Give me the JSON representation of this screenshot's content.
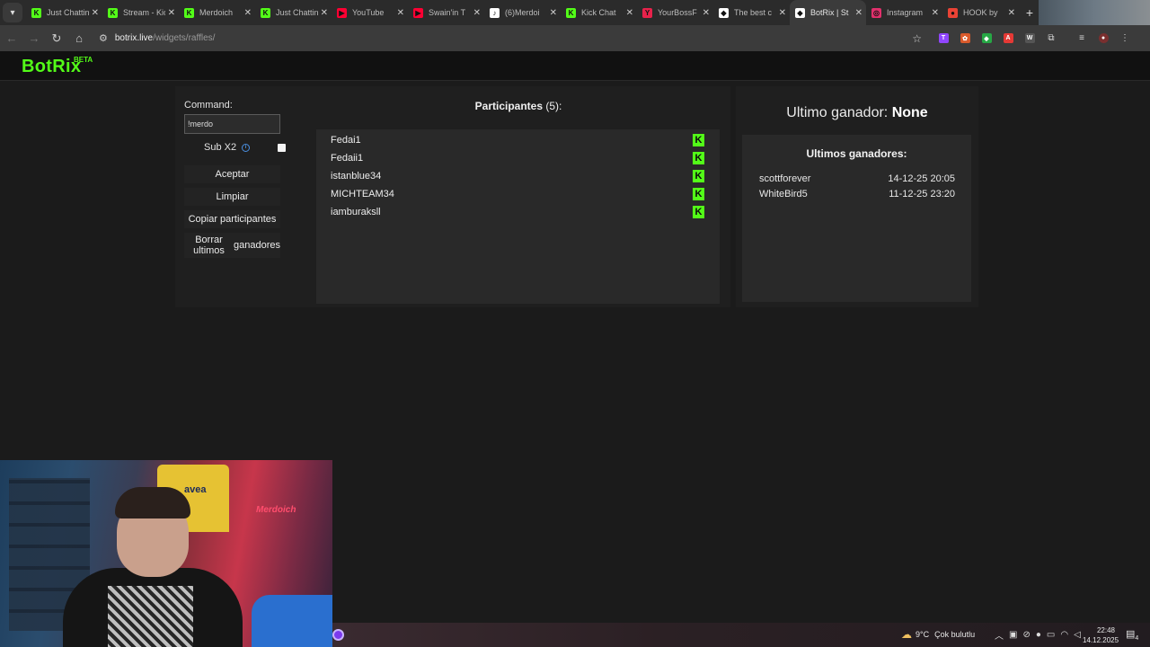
{
  "browser": {
    "tabs": [
      {
        "title": "Just Chatting",
        "fav_color": "#53fc18",
        "fav_letter": "K",
        "active": false
      },
      {
        "title": "Stream - Kick",
        "fav_color": "#53fc18",
        "fav_letter": "K",
        "active": false
      },
      {
        "title": "Merdoich",
        "fav_color": "#53fc18",
        "fav_letter": "K",
        "active": false
      },
      {
        "title": "Just Chatting",
        "fav_color": "#53fc18",
        "fav_letter": "K",
        "active": false
      },
      {
        "title": "YouTube",
        "fav_color": "#ff0033",
        "fav_letter": "▶",
        "active": false
      },
      {
        "title": "Swain'in T",
        "fav_color": "#ff0033",
        "fav_letter": "▶",
        "active": false
      },
      {
        "title": "(6)Merdoi",
        "fav_color": "#ffffff",
        "fav_letter": "♪",
        "active": false
      },
      {
        "title": "Kick Chat",
        "fav_color": "#53fc18",
        "fav_letter": "K",
        "active": false
      },
      {
        "title": "YourBossF",
        "fav_color": "#e8224b",
        "fav_letter": "Y",
        "active": false
      },
      {
        "title": "The best c",
        "fav_color": "#ffffff",
        "fav_letter": "◆",
        "active": false
      },
      {
        "title": "BotRix | St",
        "fav_color": "#ffffff",
        "fav_letter": "◆",
        "active": true
      },
      {
        "title": "Instagram",
        "fav_color": "#e1306c",
        "fav_letter": "◎",
        "active": false
      },
      {
        "title": "HOOK by",
        "fav_color": "#ea4335",
        "fav_letter": "●",
        "active": false
      }
    ],
    "url_host": "botrix.live",
    "url_path": "/widgets/raffles/"
  },
  "site": {
    "logo": "BotRix",
    "beta": "BETA"
  },
  "controls": {
    "command_label": "Command:",
    "command_value": "!merdo",
    "sub_label": "Sub X2",
    "accept": "Aceptar",
    "clear": "Limpiar",
    "copy": "Copiar participantes",
    "delete_winners_line1": "Borrar ultimos",
    "delete_winners_line2": "ganadores"
  },
  "participants": {
    "title": "Participantes",
    "count": "(5):",
    "list": [
      "Fedai1",
      "Fedaii1",
      "istanblue34",
      "MICHTEAM34",
      "iamburaksll"
    ]
  },
  "winners": {
    "last_label": "Ultimo ganador:",
    "last_value": "None",
    "box_title": "Ultimos ganadores:",
    "list": [
      {
        "name": "scottforever",
        "date": "14-12-25 20:05"
      },
      {
        "name": "WhiteBird5",
        "date": "11-12-25 23:20"
      }
    ]
  },
  "webcam": {
    "jersey_text": "avea",
    "sign_text": "Merdoich"
  },
  "taskbar": {
    "temperature": "9°C",
    "condition": "Çok bulutlu",
    "time": "22:48",
    "date": "14.12.2025",
    "notifications": "4"
  },
  "colors": {
    "kick_green": "#53fc18",
    "background": "#1b1b1b",
    "panel": "#1f1f1f",
    "list_bg": "#292929"
  }
}
